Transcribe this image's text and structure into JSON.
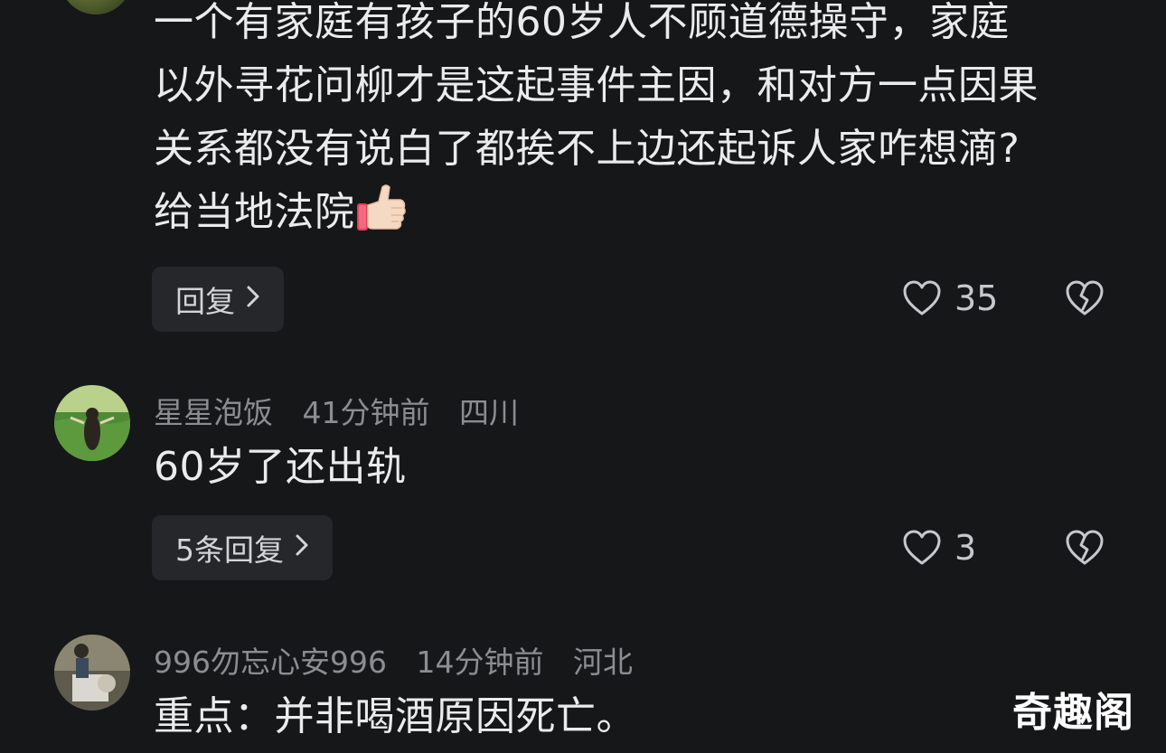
{
  "comments": [
    {
      "body_lines": [
        "一个有家庭有孩子的60岁人不顾道德操守，家庭",
        "以外寻花问柳才是这起事件主因，和对方一点因果",
        "关系都没有说白了都挨不上边还起诉人家咋想滴?",
        "给当地法院"
      ],
      "reply_label": "回复",
      "likes": "35"
    },
    {
      "username": "星星泡饭",
      "time": "41分钟前",
      "location": "四川",
      "body": "60岁了还出轨",
      "reply_label": "5条回复",
      "likes": "3"
    },
    {
      "username": "996勿忘心安996",
      "time": "14分钟前",
      "location": "河北",
      "body": "重点：并非喝酒原因死亡。"
    }
  ],
  "icons": {
    "like": "heart-outline-icon",
    "dislike": "broken-heart-icon",
    "reply_chevron": "chevron-right-icon",
    "emoji": "thumbs-up-emoji"
  },
  "watermark": "奇趣阁",
  "colors": {
    "background": "#161719",
    "text_primary": "#ebebec",
    "text_secondary": "#8c8d91",
    "button_bg": "#26272b"
  }
}
